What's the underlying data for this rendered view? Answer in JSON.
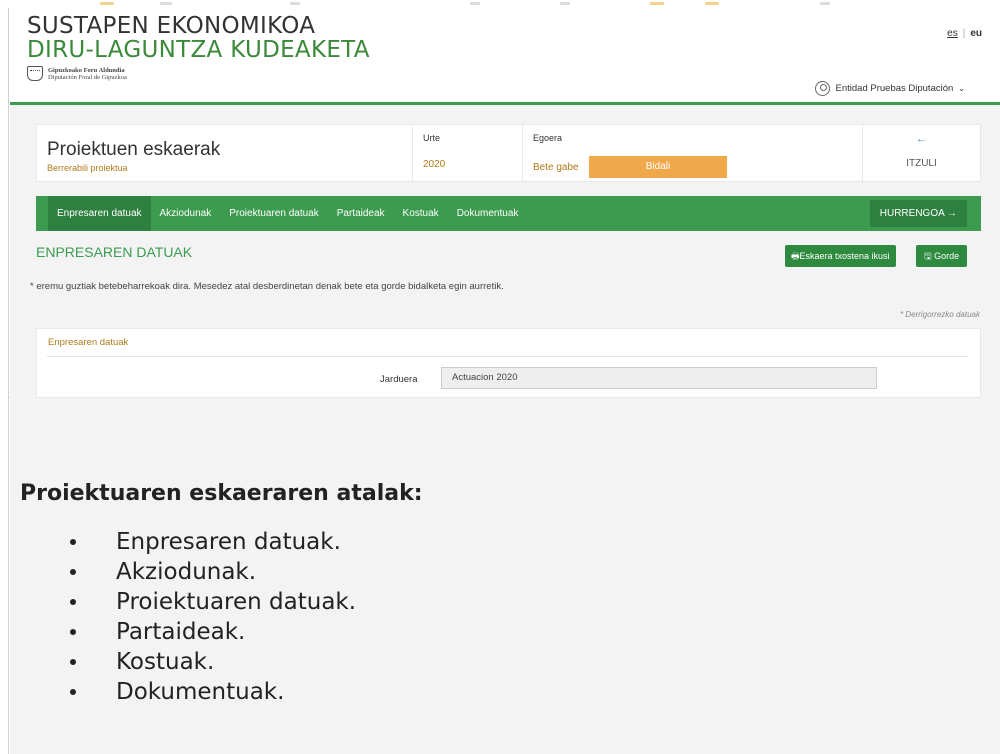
{
  "app": {
    "title_line1": "SUSTAPEN EKONOMIKOA",
    "title_line2": "DIRU-LAGUNTZA KUDEAKETA",
    "org_line1": "Gipuzkoako Foru Aldundia",
    "org_line2": "Diputación Foral de Gipuzkoa"
  },
  "lang": {
    "es": "es",
    "eu": "eu"
  },
  "user": {
    "name": "Entidad Pruebas Diputación",
    "caret": "⌄"
  },
  "summary": {
    "title": "Proiektuen eskaerak",
    "subtitle": "Berrerabili proiektua",
    "urte_label": "Urte",
    "urte_value": "2020",
    "egoera_label": "Egoera",
    "egoera_value": "Bete gabe",
    "send_button": "Bidali",
    "back_arrow": "←",
    "back_label": "ITZULI"
  },
  "tabs": [
    {
      "label": "Enpresaren datuak"
    },
    {
      "label": "Akziodunak"
    },
    {
      "label": "Proiektuaren datuak"
    },
    {
      "label": "Partaideak"
    },
    {
      "label": "Kostuak"
    },
    {
      "label": "Dokumentuak"
    }
  ],
  "next_button": "HURRENGOA →",
  "section": {
    "title": "ENPRESAREN DATUAK",
    "view_button": "🖶Eskaera txostena ikusi",
    "save_button": "🖫 Gorde",
    "note": "* eremu guztiak betebeharrekoak dira. Mesedez atal desberdinetan denak bete eta gorde bidalketa egin aurretik.",
    "required": "* Derrigorrezko datuak"
  },
  "panel": {
    "title": "Enpresaren datuak",
    "field_label": "Jarduera",
    "field_value": "Actuacion 2020"
  },
  "doc": {
    "heading": "Proiektuaren eskaeraren atalak:",
    "items": [
      "Enpresaren datuak.",
      "Akziodunak.",
      "Proiektuaren datuak.",
      "Partaideak.",
      "Kostuak.",
      "Dokumentuak."
    ]
  },
  "colors": {
    "brand_green": "#3c9b4f",
    "accent_orange": "#f0a94a",
    "text_gold": "#b07a1a"
  }
}
